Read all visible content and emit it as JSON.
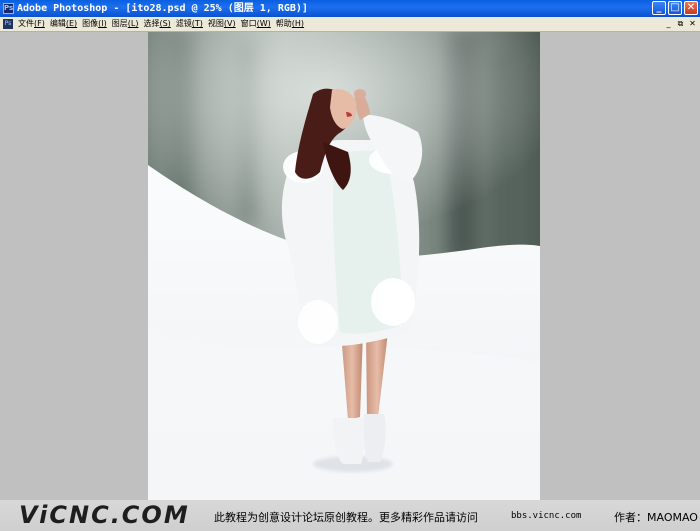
{
  "window": {
    "title": "Adobe Photoshop - [ito28.psd @ 25% (图层 1, RGB)]",
    "app_icon": "photoshop-icon",
    "buttons": {
      "minimize": "_",
      "maximize": "□",
      "close": "✕"
    }
  },
  "menubar": {
    "items": [
      {
        "label": "文件",
        "key": "(F)"
      },
      {
        "label": "编辑",
        "key": "(E)"
      },
      {
        "label": "图像",
        "key": "(I)"
      },
      {
        "label": "图层",
        "key": "(L)"
      },
      {
        "label": "选择",
        "key": "(S)"
      },
      {
        "label": "滤镜",
        "key": "(T)"
      },
      {
        "label": "视图",
        "key": "(V)"
      },
      {
        "label": "窗口",
        "key": "(W)"
      },
      {
        "label": "帮助",
        "key": "(H)"
      }
    ],
    "doc_buttons": {
      "minimize": "_",
      "restore": "⧉",
      "close": "✕"
    }
  },
  "canvas": {
    "image": "woman-in-white-fur-coat-on-snowy-hill",
    "colors": {
      "sky": "#8b9590",
      "snow": "#f5f6f8",
      "coat": "#f4f5f7",
      "hair": "#4a1c18"
    }
  },
  "footer": {
    "logo": "ViCNC.COM",
    "text": "此教程为创意设计论坛原创教程。更多精彩作品请访问",
    "url": "bbs.vicnc.com",
    "author": "作者：MAOMAO"
  }
}
